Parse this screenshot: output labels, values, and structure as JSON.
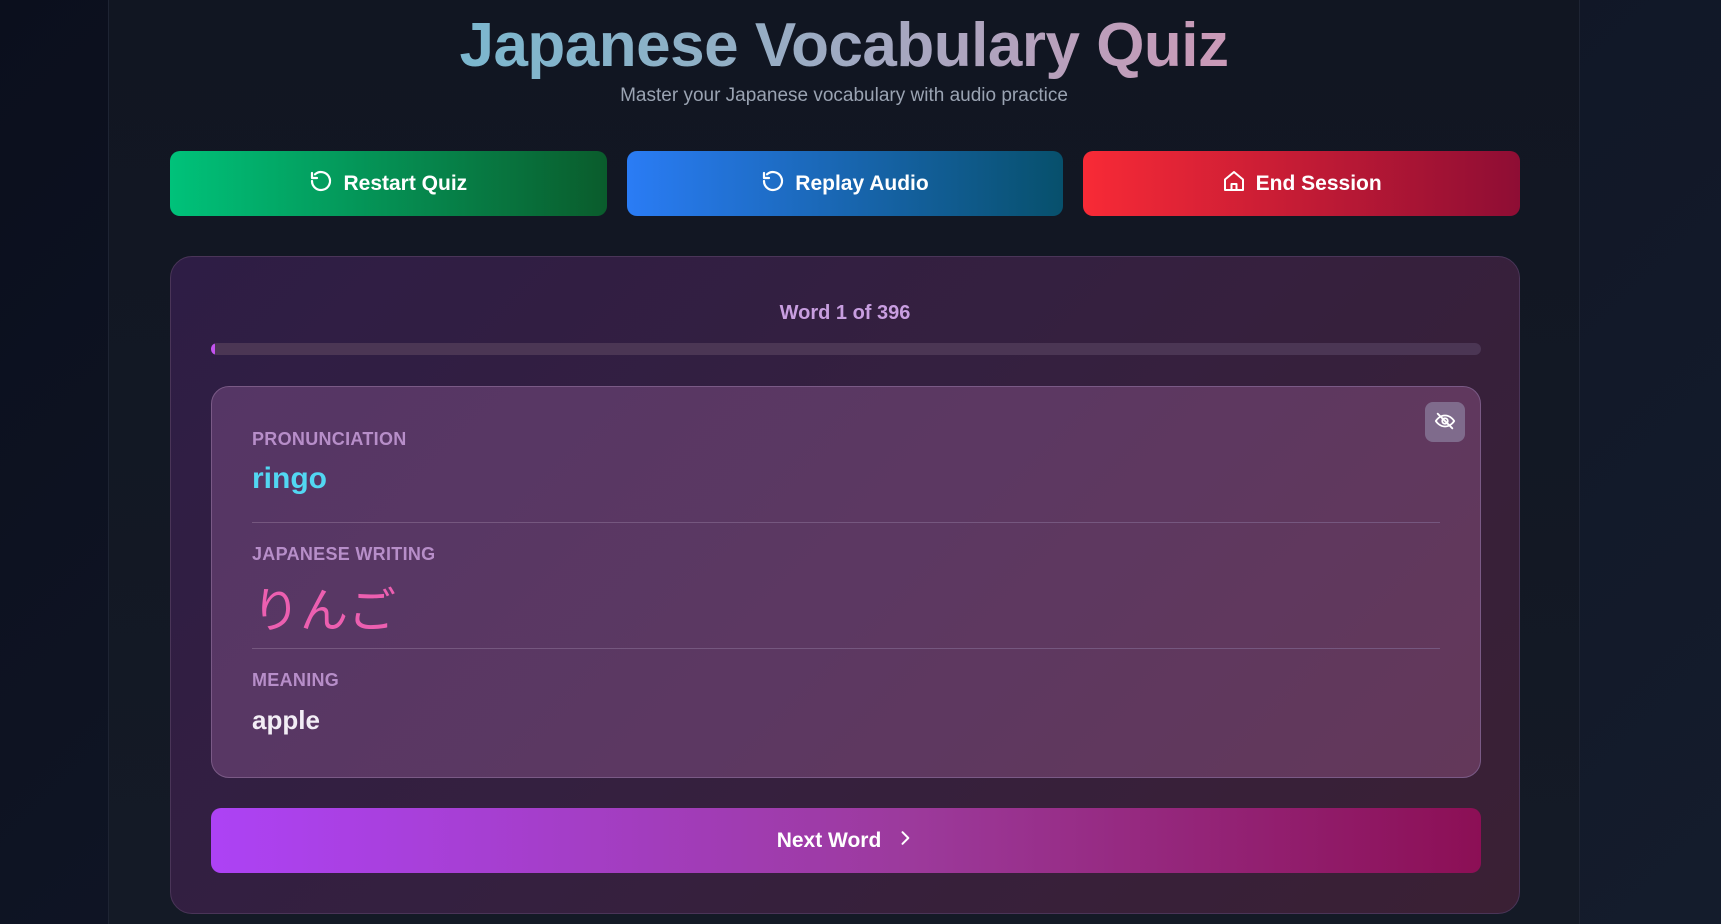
{
  "header": {
    "title": "Japanese Vocabulary Quiz",
    "subtitle": "Master your Japanese vocabulary with audio practice"
  },
  "actions": {
    "restart_label": "Restart Quiz",
    "restart_icon": "restart-icon",
    "replay_label": "Replay Audio",
    "replay_icon": "replay-icon",
    "end_label": "End Session",
    "end_icon": "home-icon"
  },
  "progress": {
    "label": "Word 1 of 396",
    "current": 1,
    "total": 396,
    "fraction": 0.0025
  },
  "word": {
    "pronunciation_label": "PRONUNCIATION",
    "pronunciation": "ringo",
    "writing_label": "JAPANESE WRITING",
    "writing": "りんご",
    "meaning_label": "MEANING",
    "meaning": "apple",
    "hide_icon": "eye-off-icon"
  },
  "next": {
    "label": "Next Word",
    "icon": "chevron-right-icon"
  },
  "colors": {
    "pronunciation": "#52d7f2",
    "writing": "#ec5fb0",
    "restart_button": "#00c27a",
    "replay_button": "#2a7cf5",
    "end_button": "#f82a36",
    "next_button": "#ad42f5"
  }
}
